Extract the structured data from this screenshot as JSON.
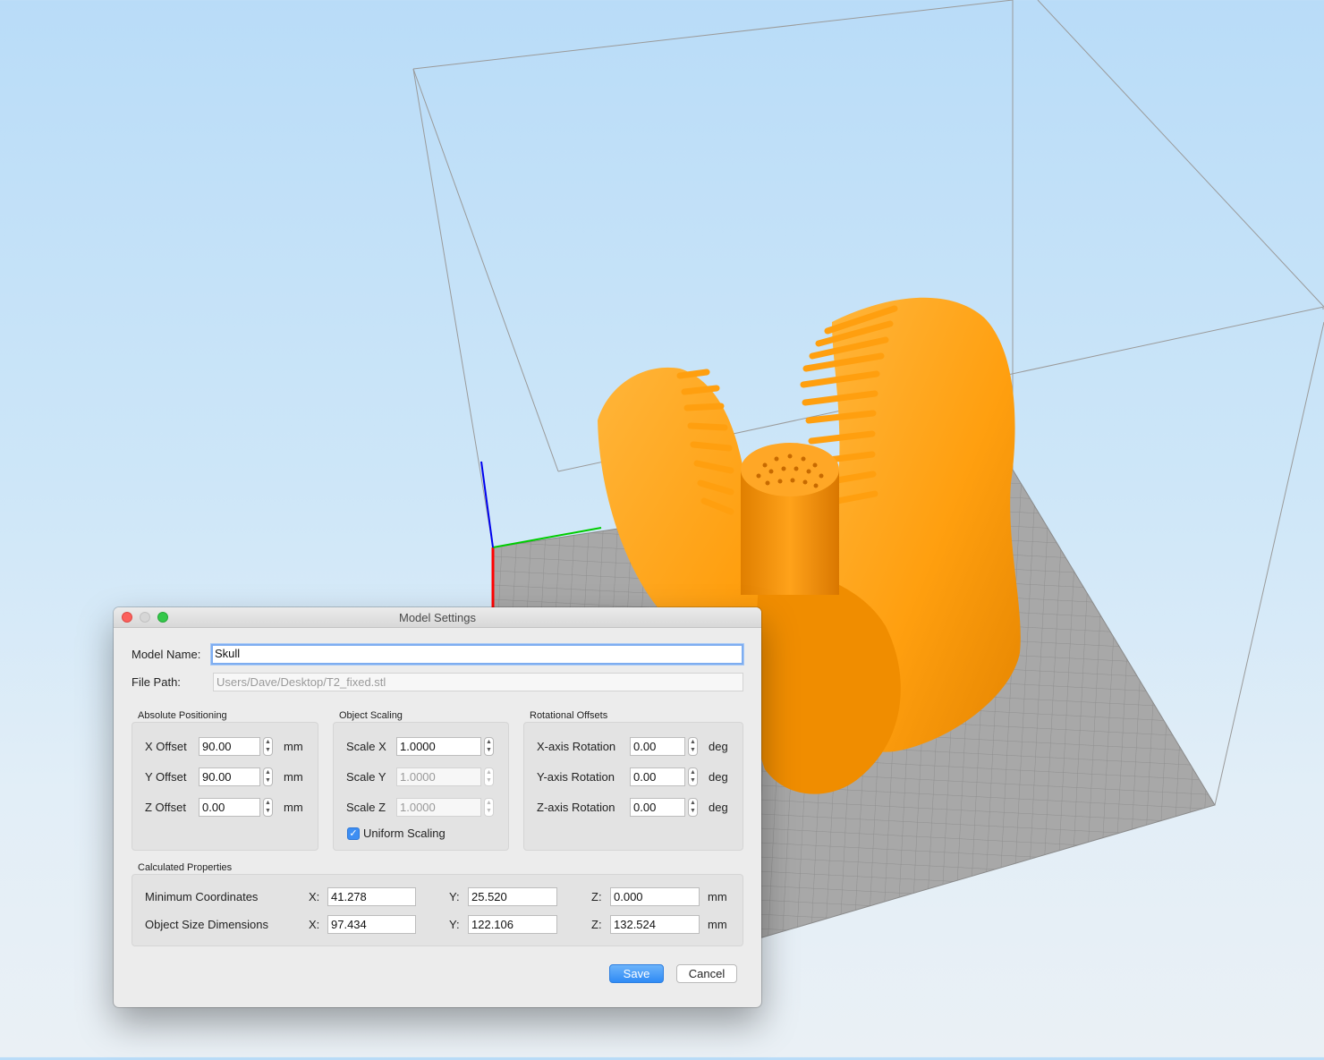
{
  "dialog": {
    "title": "Model Settings",
    "model_name_label": "Model Name:",
    "model_name_value": "Skull",
    "file_path_label": "File Path:",
    "file_path_value": "Users/Dave/Desktop/T2_fixed.stl",
    "absolute_positioning": {
      "heading": "Absolute Positioning",
      "rows": [
        {
          "label": "X Offset",
          "value": "90.00",
          "unit": "mm"
        },
        {
          "label": "Y Offset",
          "value": "90.00",
          "unit": "mm"
        },
        {
          "label": "Z Offset",
          "value": "0.00",
          "unit": "mm"
        }
      ]
    },
    "object_scaling": {
      "heading": "Object Scaling",
      "rows": [
        {
          "label": "Scale X",
          "value": "1.0000",
          "enabled": true
        },
        {
          "label": "Scale Y",
          "value": "1.0000",
          "enabled": false
        },
        {
          "label": "Scale Z",
          "value": "1.0000",
          "enabled": false
        }
      ],
      "uniform_label": "Uniform Scaling",
      "uniform_checked": true
    },
    "rotational_offsets": {
      "heading": "Rotational Offsets",
      "rows": [
        {
          "label": "X-axis Rotation",
          "value": "0.00",
          "unit": "deg"
        },
        {
          "label": "Y-axis Rotation",
          "value": "0.00",
          "unit": "deg"
        },
        {
          "label": "Z-axis Rotation",
          "value": "0.00",
          "unit": "deg"
        }
      ]
    },
    "calculated_properties": {
      "heading": "Calculated Properties",
      "rows": [
        {
          "label": "Minimum Coordinates",
          "x_label": "X:",
          "x": "41.278",
          "y_label": "Y:",
          "y": "25.520",
          "z_label": "Z:",
          "z": "0.000",
          "unit": "mm"
        },
        {
          "label": "Object Size Dimensions",
          "x_label": "X:",
          "x": "97.434",
          "y_label": "Y:",
          "y": "122.106",
          "z_label": "Z:",
          "z": "132.524",
          "unit": "mm"
        }
      ]
    },
    "save_label": "Save",
    "cancel_label": "Cancel"
  },
  "scene": {
    "model_color": "#ff9f0f",
    "model_shade_color": "#e07f00",
    "bed_color": "#a7a7a7",
    "axis_colors": {
      "x": "#ff0000",
      "y": "#00cc00",
      "z": "#0000ee"
    }
  }
}
